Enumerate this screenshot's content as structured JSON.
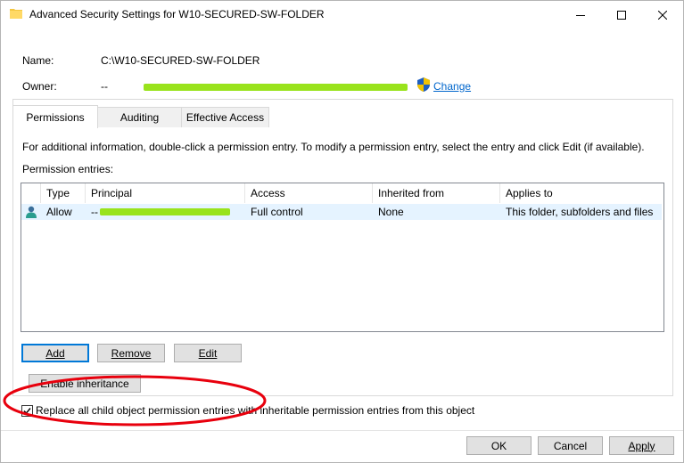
{
  "window": {
    "title": "Advanced Security Settings for W10-SECURED-SW-FOLDER",
    "controls": [
      "minimize-icon",
      "maximize-icon",
      "close-icon"
    ]
  },
  "info": {
    "name_label": "Name:",
    "name_value": "C:\\W10-SECURED-SW-FOLDER",
    "owner_label": "Owner:",
    "owner_prefix": "--",
    "change_label": "Change"
  },
  "tabs": [
    {
      "label": "Permissions",
      "active": true
    },
    {
      "label": "Auditing",
      "active": false
    },
    {
      "label": "Effective Access",
      "active": false
    }
  ],
  "permissions": {
    "info_text": "For additional information, double-click a permission entry. To modify a permission entry, select the entry and click Edit (if available).",
    "entries_label": "Permission entries:",
    "columns": [
      "Type",
      "Principal",
      "Access",
      "Inherited from",
      "Applies to"
    ],
    "rows": [
      {
        "icon": "user-icon",
        "type": "Allow",
        "principal": "--",
        "access": "Full control",
        "inherited_from": "None",
        "applies_to": "This folder, subfolders and files"
      }
    ],
    "add_label": "Add",
    "remove_label": "Remove",
    "edit_label": "Edit",
    "enable_inheritance_label": "Enable inheritance",
    "replace_checkbox_label": "Replace all child object permission entries with inheritable permission entries from this object",
    "replace_checked": true
  },
  "footer": {
    "ok_label": "OK",
    "cancel_label": "Cancel",
    "apply_label": "Apply"
  },
  "colors": {
    "redaction": "#99e31c",
    "annotation": "#e8000d",
    "link": "#0066cc",
    "selection": "#e5f3ff"
  }
}
